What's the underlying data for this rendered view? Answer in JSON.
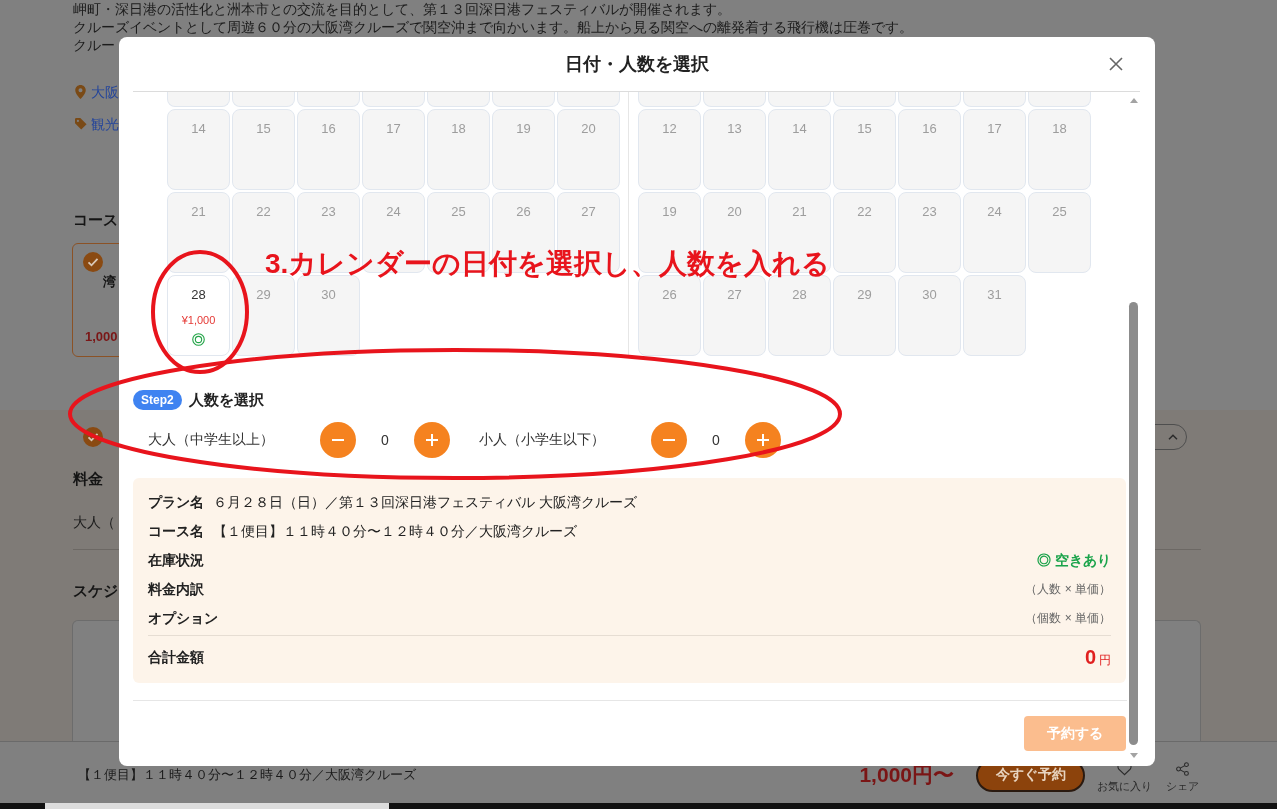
{
  "background_page": {
    "intro_lines": [
      "岬町・深日港の活性化と洲本市との交流を目的として、第１３回深日港フェスティバルが開催されます。",
      "クルーズイベントとして周遊６０分の大阪湾クルーズで関空沖まで向かいます。船上から見る関空への離発着する飛行機は圧巻です。",
      "クルー"
    ],
    "tags": [
      {
        "kind": "location",
        "label": "大阪"
      },
      {
        "kind": "category",
        "label": "観光"
      }
    ],
    "course_heading": "コース",
    "course_card": {
      "selected": true,
      "title_fragment": "湾",
      "price": "1,000"
    },
    "fee_section": {
      "checked": true,
      "heading": "料金",
      "row_fragment": "大人（",
      "schedule_heading": "スケジ"
    }
  },
  "bottom_bar": {
    "course": "【１便目】１１時４０分〜１２時４０分／大阪湾クルーズ",
    "price": "1,000円〜",
    "book_button": "今すぐ予約",
    "actions": [
      {
        "kind": "favorite",
        "label": "お気に入り"
      },
      {
        "kind": "share",
        "label": "シェア"
      }
    ]
  },
  "modal": {
    "title": "日付・人数を選択",
    "calendar": {
      "months": [
        {
          "partial_top_row": true,
          "weeks": [
            [
              {
                "day": "14",
                "available": false
              },
              {
                "day": "15",
                "available": false
              },
              {
                "day": "16",
                "available": false
              },
              {
                "day": "17",
                "available": false
              },
              {
                "day": "18",
                "available": false
              },
              {
                "day": "19",
                "available": false
              },
              {
                "day": "20",
                "available": false
              }
            ],
            [
              {
                "day": "21",
                "available": false
              },
              {
                "day": "22",
                "available": false
              },
              {
                "day": "23",
                "available": false
              },
              {
                "day": "24",
                "available": false
              },
              {
                "day": "25",
                "available": false
              },
              {
                "day": "26",
                "available": false
              },
              {
                "day": "27",
                "available": false
              }
            ],
            [
              {
                "day": "28",
                "available": true,
                "price": "¥1,000"
              },
              {
                "day": "29",
                "available": false
              },
              {
                "day": "30",
                "available": false
              }
            ]
          ]
        },
        {
          "partial_top_row": true,
          "weeks": [
            [
              {
                "day": "12",
                "available": false
              },
              {
                "day": "13",
                "available": false
              },
              {
                "day": "14",
                "available": false
              },
              {
                "day": "15",
                "available": false
              },
              {
                "day": "16",
                "available": false
              },
              {
                "day": "17",
                "available": false
              },
              {
                "day": "18",
                "available": false
              }
            ],
            [
              {
                "day": "19",
                "available": false
              },
              {
                "day": "20",
                "available": false
              },
              {
                "day": "21",
                "available": false
              },
              {
                "day": "22",
                "available": false
              },
              {
                "day": "23",
                "available": false
              },
              {
                "day": "24",
                "available": false
              },
              {
                "day": "25",
                "available": false
              }
            ],
            [
              {
                "day": "26",
                "available": false
              },
              {
                "day": "27",
                "available": false
              },
              {
                "day": "28",
                "available": false
              },
              {
                "day": "29",
                "available": false
              },
              {
                "day": "30",
                "available": false
              },
              {
                "day": "31",
                "available": false
              }
            ]
          ]
        }
      ]
    },
    "step": {
      "badge": "Step2",
      "heading": "人数を選択"
    },
    "guests": [
      {
        "label": "大人（中学生以上）",
        "count": "0"
      },
      {
        "label": "小人（小学生以下）",
        "count": "0"
      }
    ],
    "summary": {
      "rows": [
        {
          "kind": "inline",
          "label": "プラン名",
          "value": "６月２８日（日）／第１３回深日港フェスティバル 大阪湾クルーズ"
        },
        {
          "kind": "inline",
          "label": "コース名",
          "value": "【１便目】１１時４０分〜１２時４０分／大阪湾クルーズ"
        },
        {
          "kind": "status",
          "label": "在庫状況",
          "value": "◎ 空きあり"
        },
        {
          "kind": "note",
          "label": "料金内訳",
          "value": "（人数 × 単価）"
        },
        {
          "kind": "note",
          "label": "オプション",
          "value": "（個数 × 単価）"
        }
      ],
      "total": {
        "label": "合計金額",
        "amount": "0",
        "unit": "円"
      }
    },
    "reserve_button": {
      "label": "予約する",
      "disabled": true
    }
  },
  "annotations": {
    "instruction": "3.カレンダーの日付を選択し、人数を入れる",
    "circle_date": true,
    "circle_guests": true
  }
}
